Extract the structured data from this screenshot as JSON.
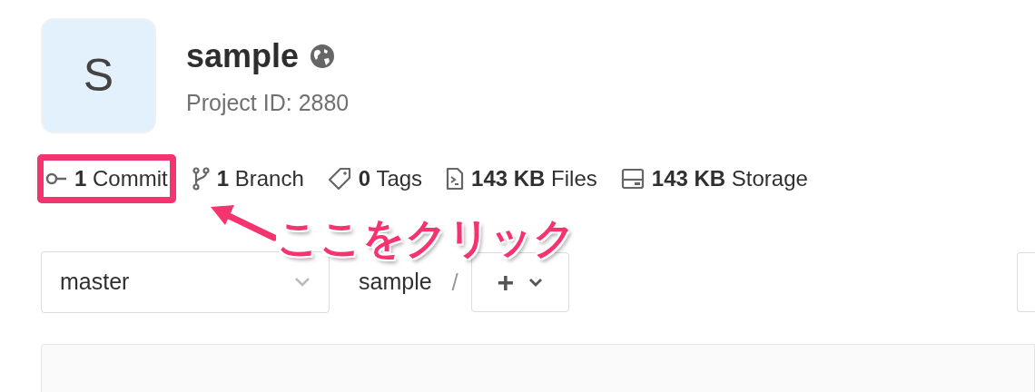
{
  "project": {
    "avatar_letter": "S",
    "name": "sample",
    "project_id": "Project ID: 2880"
  },
  "stats": [
    {
      "kind": "commit",
      "text": "**1** Commit",
      "highlighted": true
    },
    {
      "kind": "branch",
      "text": "**1** Branch",
      "highlighted": false
    },
    {
      "kind": "tag",
      "text": "**0** Tags",
      "highlighted": false
    },
    {
      "kind": "files",
      "text": "**143 KB** Files",
      "highlighted": false
    },
    {
      "kind": "storage",
      "text": "**143 KB** Storage",
      "highlighted": false
    }
  ],
  "annotation": {
    "text": "ここをクリック"
  },
  "toolbar": {
    "branch": "master",
    "path": "sample",
    "separator": "/",
    "add_button": "+"
  }
}
